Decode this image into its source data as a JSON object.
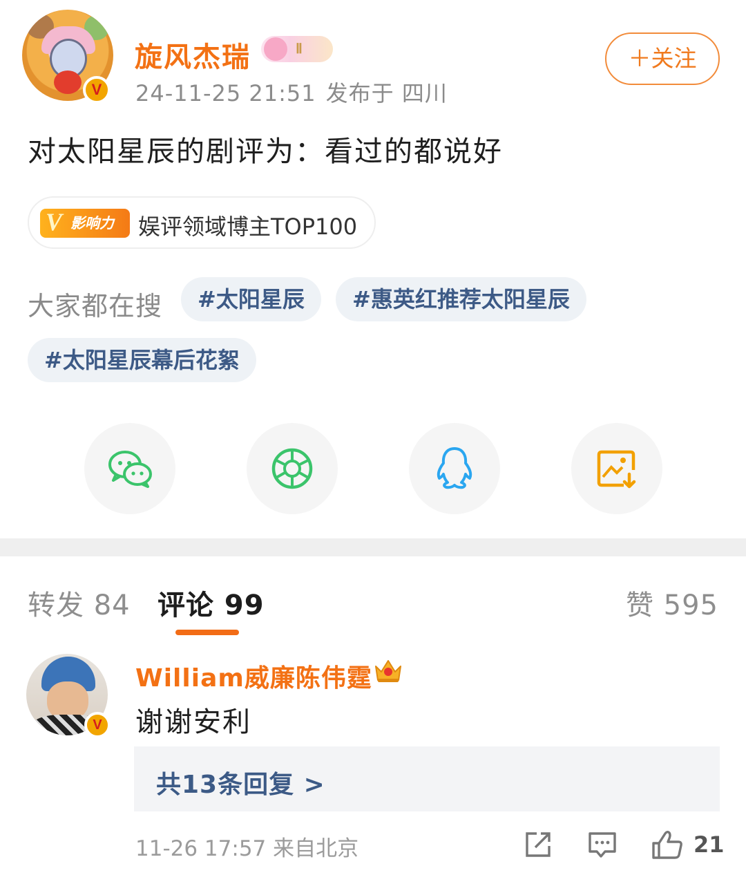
{
  "post": {
    "author": {
      "name": "旋风杰瑞",
      "fan_badge_level": "Ⅱ",
      "verified": "V"
    },
    "timestamp": "24-11-25 21:51",
    "location": "发布于 四川",
    "follow_label": "＋关注",
    "text": "对太阳星辰的剧评为：看过的都说好",
    "influence": {
      "tag_v": "V",
      "tag_label": "影响力",
      "text": "娱评领域博主TOP100"
    },
    "trending": {
      "label": "大家都在搜",
      "tags": [
        "#太阳星辰",
        "#惠英红推荐太阳星辰",
        "#太阳星辰幕后花絮"
      ]
    },
    "share_targets": [
      {
        "icon": "wechat-icon",
        "color": "#3bc46b"
      },
      {
        "icon": "moments-icon",
        "color": "#3bc46b"
      },
      {
        "icon": "qq-icon",
        "color": "#2aa6f0"
      },
      {
        "icon": "save-image-icon",
        "color": "#f2a000"
      }
    ]
  },
  "tabs": {
    "repost": "转发 84",
    "comment": "评论 99",
    "like": "赞 595"
  },
  "comment": {
    "user": "William威廉陈伟霆",
    "verified": "V",
    "text": "谢谢安利",
    "replies_label": "共13条回复 >",
    "time": "11-26 17:57",
    "location": "来自北京",
    "like_count": "21"
  },
  "colors": {
    "accent": "#f37114",
    "link": "#3c5a86"
  }
}
